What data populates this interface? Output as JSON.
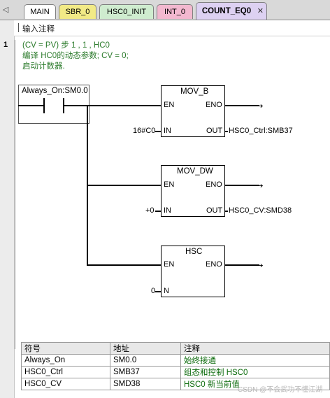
{
  "tabs": [
    {
      "label": "MAIN",
      "color": "#ffffff"
    },
    {
      "label": "SBR_0",
      "color": "#f2ea86"
    },
    {
      "label": "HSC0_INIT",
      "color": "#cfeccf"
    },
    {
      "label": "INT_0",
      "color": "#f2b8cf"
    },
    {
      "label": "COUNT_EQ0",
      "color": "#ddd1f2",
      "active": true
    }
  ],
  "editor": {
    "comment_placeholder": "输入注释",
    "network_number": "1",
    "network_comment": [
      "(CV = PV) 步 1 , 1 , HC0",
      "编译 HC0的动态参数; CV = 0;",
      "启动计数器."
    ]
  },
  "ladder": {
    "contact_label": "Always_On:SM0.0",
    "boxes": [
      {
        "title": "MOV_B",
        "en": "EN",
        "eno": "ENO",
        "in": "IN",
        "out": "OUT",
        "in_value": "16#C0",
        "out_value": "HSC0_Ctrl:SMB37"
      },
      {
        "title": "MOV_DW",
        "en": "EN",
        "eno": "ENO",
        "in": "IN",
        "out": "OUT",
        "in_value": "+0",
        "out_value": "HSC0_CV:SMD38"
      },
      {
        "title": "HSC",
        "en": "EN",
        "eno": "ENO",
        "in": "N",
        "in_value": "0"
      }
    ]
  },
  "symbol_table": {
    "headers": [
      "符号",
      "地址",
      "注释"
    ],
    "rows": [
      [
        "Always_On",
        "SM0.0",
        "始终接通"
      ],
      [
        "HSC0_Ctrl",
        "SMB37",
        "组态和控制 HSC0"
      ],
      [
        "HSC0_CV",
        "SMD38",
        "HSC0 新当前值"
      ]
    ]
  },
  "watermark": "CSDN @不会武功不懂江湖"
}
